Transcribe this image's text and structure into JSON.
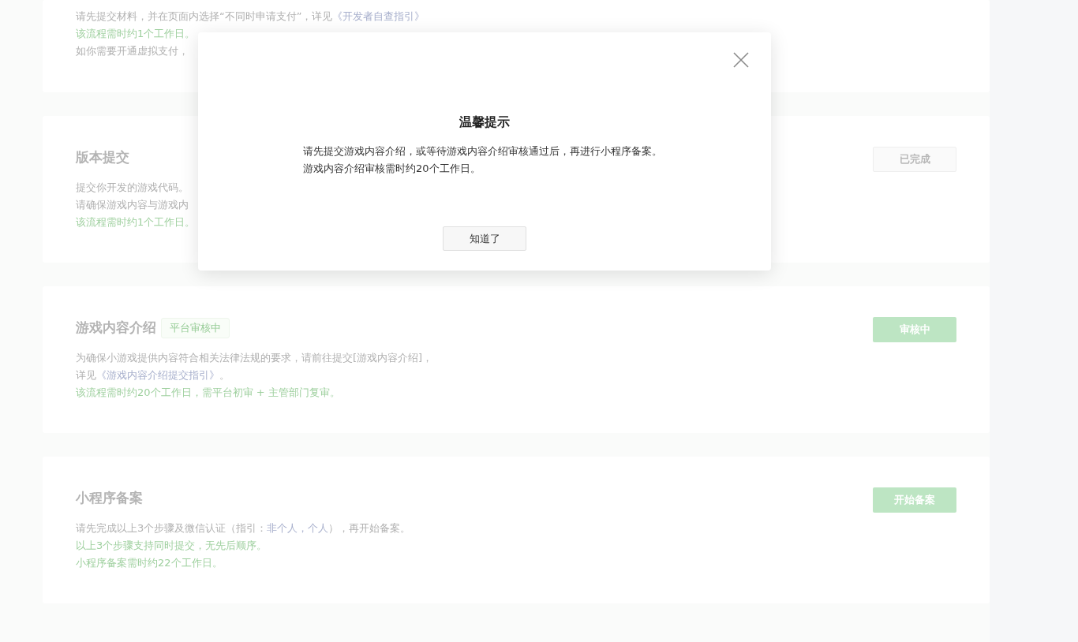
{
  "cards": [
    {
      "lines": [
        {
          "kind": "note",
          "segments": [
            {
              "kind": "text",
              "text": "请先提交材料，并在页面内选择“不同时申请支付”，详见"
            },
            {
              "kind": "link",
              "text": "《开发者自查指引》"
            }
          ]
        },
        {
          "kind": "duration",
          "segments": [
            {
              "kind": "text",
              "text": "该流程需时约1个工作日。"
            }
          ]
        },
        {
          "kind": "note",
          "segments": [
            {
              "kind": "text",
              "text": "如你需要开通虚拟支付，"
            }
          ]
        }
      ]
    },
    {
      "title": "版本提交",
      "button": {
        "label": "已完成",
        "kind": "done"
      },
      "lines": [
        {
          "kind": "note",
          "segments": [
            {
              "kind": "text",
              "text": "提交你开发的游戏代码。"
            }
          ]
        },
        {
          "kind": "note",
          "segments": [
            {
              "kind": "text",
              "text": "请确保游戏内容与游戏内"
            }
          ]
        },
        {
          "kind": "duration",
          "segments": [
            {
              "kind": "text",
              "text": "该流程需时约1个工作日。"
            }
          ]
        }
      ]
    },
    {
      "title": "游戏内容介绍",
      "badge": "平台审核中",
      "button": {
        "label": "审核中",
        "kind": "active"
      },
      "lines": [
        {
          "kind": "note",
          "segments": [
            {
              "kind": "text",
              "text": "为确保小游戏提供内容符合相关法律法规的要求，请前往提交[游戏内容介绍]，"
            }
          ]
        },
        {
          "kind": "note",
          "segments": [
            {
              "kind": "text",
              "text": "详见"
            },
            {
              "kind": "link",
              "text": "《游戏内容介绍提交指引》"
            },
            {
              "kind": "text",
              "text": "。"
            }
          ]
        },
        {
          "kind": "duration",
          "segments": [
            {
              "kind": "text",
              "text": "该流程需时约20个工作日，需平台初审 + 主管部门复审。"
            }
          ]
        }
      ]
    },
    {
      "title": "小程序备案",
      "button": {
        "label": "开始备案",
        "kind": "active"
      },
      "lines": [
        {
          "kind": "note",
          "segments": [
            {
              "kind": "text",
              "text": "请先完成以上3个步骤及微信认证（指引："
            },
            {
              "kind": "link",
              "text": "非个人，"
            },
            {
              "kind": "link",
              "text": "个人"
            },
            {
              "kind": "text",
              "text": "），再开始备案。"
            }
          ]
        },
        {
          "kind": "duration",
          "segments": [
            {
              "kind": "text",
              "text": "以上3个步骤支持同时提交，无先后顺序。"
            }
          ]
        },
        {
          "kind": "duration",
          "segments": [
            {
              "kind": "text",
              "text": "小程序备案需时约22个工作日。"
            }
          ]
        }
      ]
    }
  ],
  "dialog": {
    "title": "温馨提示",
    "body": [
      "请先提交游戏内容介绍，或等待游戏内容介绍审核通过后，再进行小程序备案。",
      "游戏内容介绍审核需时约20个工作日。"
    ],
    "button": "知道了"
  }
}
